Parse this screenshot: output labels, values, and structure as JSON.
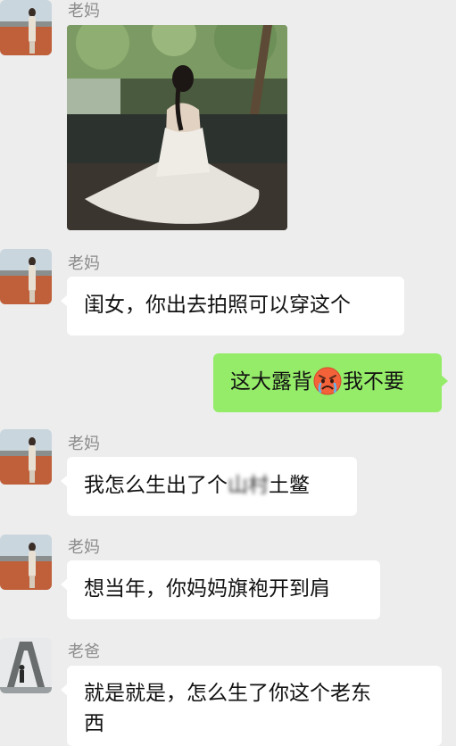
{
  "messages": [
    {
      "sender": "老妈",
      "type": "image"
    },
    {
      "sender": "老妈",
      "text": "闺女，你出去拍照可以穿这个"
    },
    {
      "sender": "me",
      "text_before": "这大露背",
      "emoji": "crying-angry-emoji",
      "text_after": "我不要"
    },
    {
      "sender": "老妈",
      "text_before": "我怎么生出了个",
      "text_obscured": "山村",
      "text_after": "土鳖"
    },
    {
      "sender": "老妈",
      "text": "想当年，你妈妈旗袍开到肩"
    },
    {
      "sender": "老爸",
      "text_line1": "就是就是，怎么生了你这个老东",
      "text_line2": "西"
    }
  ],
  "colors": {
    "background": "#ededed",
    "bubble_in": "#ffffff",
    "bubble_out": "#95ec69"
  }
}
